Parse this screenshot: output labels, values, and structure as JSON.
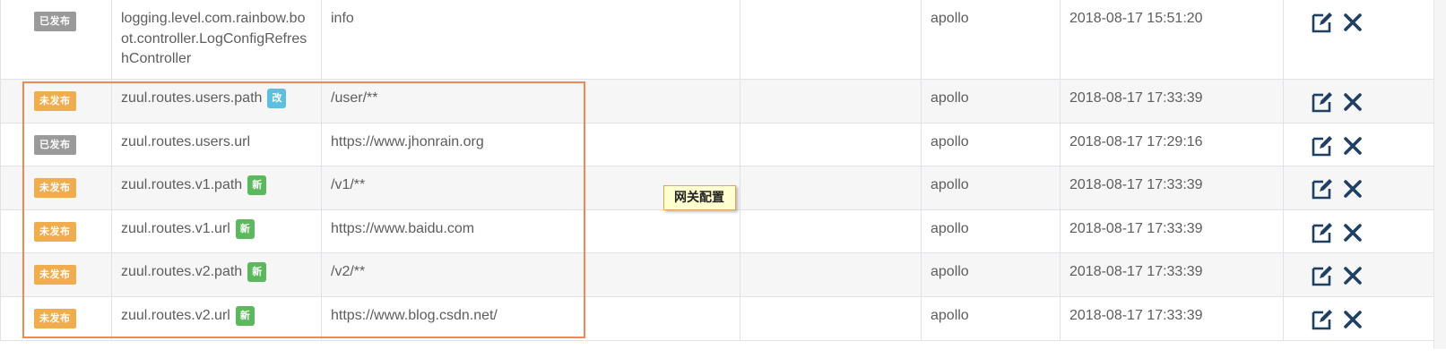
{
  "rows": [
    {
      "status": "已发布",
      "status_kind": "published",
      "key": "logging.level.com.rainbow.boot.controller.LogConfigRefreshController",
      "tag": "",
      "tag_kind": "",
      "value": "info",
      "comment": "",
      "user": "apollo",
      "time": "2018-08-17 15:51:20"
    },
    {
      "status": "未发布",
      "status_kind": "unpublished",
      "key": "zuul.routes.users.path",
      "tag": "改",
      "tag_kind": "modified",
      "value": "/user/**",
      "comment": "",
      "user": "apollo",
      "time": "2018-08-17 17:33:39"
    },
    {
      "status": "已发布",
      "status_kind": "published",
      "key": "zuul.routes.users.url",
      "tag": "",
      "tag_kind": "",
      "value": "https://www.jhonrain.org",
      "comment": "",
      "user": "apollo",
      "time": "2018-08-17 17:29:16"
    },
    {
      "status": "未发布",
      "status_kind": "unpublished",
      "key": "zuul.routes.v1.path",
      "tag": "新",
      "tag_kind": "new",
      "value": "/v1/**",
      "comment": "",
      "user": "apollo",
      "time": "2018-08-17 17:33:39"
    },
    {
      "status": "未发布",
      "status_kind": "unpublished",
      "key": "zuul.routes.v1.url",
      "tag": "新",
      "tag_kind": "new",
      "value": "https://www.baidu.com",
      "comment": "",
      "user": "apollo",
      "time": "2018-08-17 17:33:39"
    },
    {
      "status": "未发布",
      "status_kind": "unpublished",
      "key": "zuul.routes.v2.path",
      "tag": "新",
      "tag_kind": "new",
      "value": "/v2/**",
      "comment": "",
      "user": "apollo",
      "time": "2018-08-17 17:33:39"
    },
    {
      "status": "未发布",
      "status_kind": "unpublished",
      "key": "zuul.routes.v2.url",
      "tag": "新",
      "tag_kind": "new",
      "value": "https://www.blog.csdn.net/",
      "comment": "",
      "user": "apollo",
      "time": "2018-08-17 17:33:39"
    }
  ],
  "annotation": {
    "label": "网关配置",
    "box_color": "#ea8b55"
  },
  "icons": {
    "edit": "edit-icon",
    "delete": "close-icon"
  },
  "colors": {
    "published": "#9a9a9a",
    "unpublished": "#f0ad4e",
    "tag_modified": "#5bc0de",
    "tag_new": "#5cb85c",
    "icon": "#1f4e79"
  }
}
